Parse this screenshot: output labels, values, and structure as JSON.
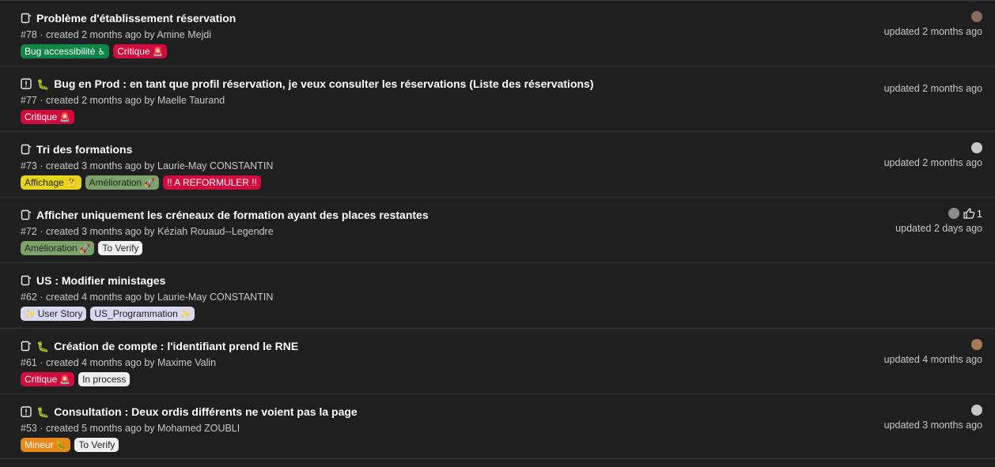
{
  "issues": [
    {
      "title": "Problème d'établissement réservation",
      "meta": "#78 · created 2 months ago by Amine Mejdi",
      "status_icon": "issue-open-icon",
      "emoji": "",
      "has_avatar": true,
      "avatar_color": "#8a6b5a",
      "likes": "",
      "updated": "updated 2 months ago",
      "labels": [
        {
          "text": "Bug accessibilité",
          "emoji": "♿",
          "bg": "#108548",
          "fg": "#ffffff"
        },
        {
          "text": "Critique",
          "emoji": "🚨",
          "bg": "#d10c3d",
          "fg": "#ffffff"
        }
      ]
    },
    {
      "title": "Bug en Prod : en tant que profil réservation, je veux consulter les réservations (Liste des réservations)",
      "meta": "#77 · created 2 months ago by Maelle Taurand",
      "status_icon": "issue-incident-icon",
      "emoji": "🐛",
      "has_avatar": false,
      "avatar_color": "",
      "likes": "",
      "updated": "updated 2 months ago",
      "labels": [
        {
          "text": "Critique",
          "emoji": "🚨",
          "bg": "#d10c3d",
          "fg": "#ffffff"
        }
      ]
    },
    {
      "title": "Tri des formations",
      "meta": "#73 · created 3 months ago by Laurie-May CONSTANTIN",
      "status_icon": "issue-open-icon",
      "emoji": "",
      "has_avatar": true,
      "avatar_color": "#c8c8c8",
      "likes": "",
      "updated": "updated 2 months ago",
      "labels": [
        {
          "text": "Affichage",
          "emoji": "🤔",
          "bg": "#e6d51a",
          "fg": "#1f1f1f"
        },
        {
          "text": "Amélioration",
          "emoji": "🚀",
          "bg": "#7ca46a",
          "fg": "#1f1f1f"
        },
        {
          "text": "!! A REFORMULER !!",
          "emoji": "",
          "bg": "#d10c3d",
          "fg": "#ffffff"
        }
      ]
    },
    {
      "title": "Afficher uniquement les créneaux de formation ayant des places restantes",
      "meta": "#72 · created 3 months ago by Kéziah Rouaud--Legendre",
      "status_icon": "issue-open-icon",
      "emoji": "",
      "has_avatar": true,
      "avatar_color": "#8c8c8c",
      "likes": "1",
      "updated": "updated 2 days ago",
      "labels": [
        {
          "text": "Amélioration",
          "emoji": "🚀",
          "bg": "#7ca46a",
          "fg": "#1f1f1f"
        },
        {
          "text": "To Verify",
          "emoji": "",
          "bg": "#f0f0f0",
          "fg": "#1f1f1f"
        }
      ]
    },
    {
      "title": "US : Modifier ministages",
      "meta": "#62 · created 4 months ago by Laurie-May CONSTANTIN",
      "status_icon": "issue-open-icon",
      "emoji": "",
      "has_avatar": false,
      "avatar_color": "",
      "likes": "",
      "updated": "",
      "labels": [
        {
          "text": "User Story",
          "emoji": "✨",
          "bg": "#d8d8f0",
          "fg": "#1f1f1f",
          "lead_emoji": true
        },
        {
          "text": "US_Programmation",
          "emoji": "✨",
          "bg": "#d8d8f0",
          "fg": "#1f1f1f"
        }
      ]
    },
    {
      "title": "Création de compte : l'identifiant prend le RNE",
      "meta": "#61 · created 4 months ago by Maxime Valin",
      "status_icon": "issue-open-icon",
      "emoji": "🐛",
      "has_avatar": true,
      "avatar_color": "#a87858",
      "likes": "",
      "updated": "updated 4 months ago",
      "labels": [
        {
          "text": "Critique",
          "emoji": "🚨",
          "bg": "#d10c3d",
          "fg": "#ffffff"
        },
        {
          "text": "In process",
          "emoji": "",
          "bg": "#f0f0f0",
          "fg": "#1f1f1f"
        }
      ]
    },
    {
      "title": "Consultation : Deux ordis différents ne voient pas la page",
      "meta": "#53 · created 5 months ago by Mohamed ZOUBLI",
      "status_icon": "issue-incident-icon",
      "emoji": "🐛",
      "has_avatar": true,
      "avatar_color": "#c8c8c8",
      "likes": "",
      "updated": "updated 3 months ago",
      "labels": [
        {
          "text": "Mineur",
          "emoji": "🐛",
          "bg": "#e8891a",
          "fg": "#ffffff"
        },
        {
          "text": "To Verify",
          "emoji": "",
          "bg": "#f0f0f0",
          "fg": "#1f1f1f"
        }
      ]
    }
  ]
}
